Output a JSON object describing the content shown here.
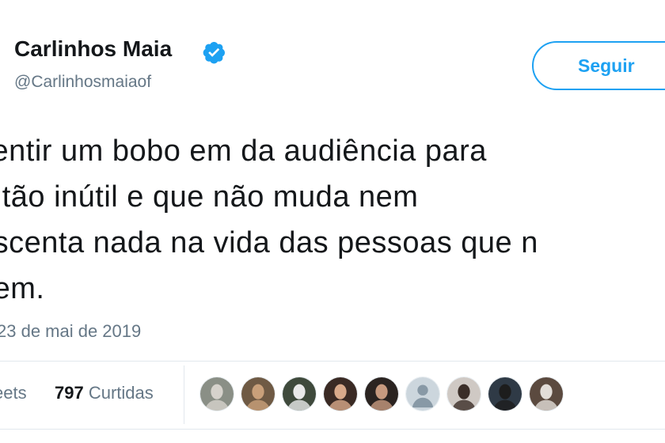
{
  "tweet": {
    "author_name": "Carlinhos Maia",
    "handle": "@Carlinhosmaiaof",
    "follow_label": "Seguir",
    "text_lines": [
      "sentir um bobo em da audiência para",
      "o tão inútil e que não muda nem",
      "escenta nada na vida das pessoas que n",
      "uem."
    ],
    "timestamp": "23 de mai de 2019",
    "retweets_label": "eets",
    "likes_count": "797",
    "likes_label": "Curtidas",
    "accent_color": "#1da1f2"
  },
  "likers": [
    {
      "icon": "liker-photo-avatar",
      "bg": "#8a8f86",
      "fg": "#d6d2cc"
    },
    {
      "icon": "liker-photo-avatar",
      "bg": "#6f5a44",
      "fg": "#c9a07a"
    },
    {
      "icon": "liker-photo-avatar",
      "bg": "#3f4a3c",
      "fg": "#e9e9e9"
    },
    {
      "icon": "liker-photo-avatar",
      "bg": "#3a2a24",
      "fg": "#d8a98a"
    },
    {
      "icon": "liker-photo-avatar",
      "bg": "#2b2421",
      "fg": "#c79a7f"
    },
    {
      "icon": "default-profile-avatar",
      "bg": "#ccd6dd",
      "fg": "#8899a6"
    },
    {
      "icon": "liker-photo-avatar",
      "bg": "#cfc9c4",
      "fg": "#3b2e28"
    },
    {
      "icon": "liker-photo-avatar",
      "bg": "#2f3a46",
      "fg": "#1d1d1d"
    },
    {
      "icon": "liker-photo-avatar",
      "bg": "#5b4a3f",
      "fg": "#e2ddd8"
    }
  ]
}
